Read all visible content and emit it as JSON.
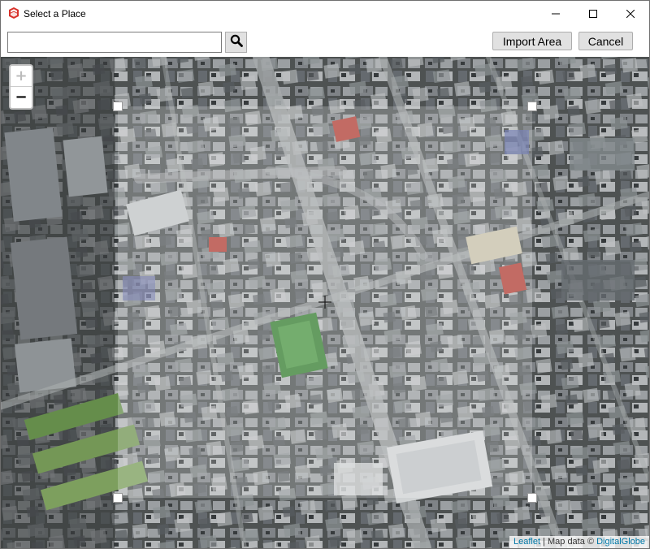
{
  "window": {
    "title": "Select a Place",
    "app_icon": "sketchup-logo-icon",
    "controls": [
      "minimize-icon",
      "maximize-icon",
      "close-icon"
    ]
  },
  "toolbar": {
    "search_value": "",
    "search_placeholder": "",
    "search_button_icon": "search-icon",
    "import_label": "Import Area",
    "cancel_label": "Cancel"
  },
  "map": {
    "zoom_in_label": "+",
    "zoom_out_label": "−",
    "selection_center_icon": "crosshair-icon",
    "attribution": {
      "provider_link": "Leaflet",
      "separator": " | Map data © ",
      "imagery_link": "DigitalGlobe"
    }
  },
  "colors": {
    "accent_link": "#0078a8",
    "app_icon_red": "#d8322a",
    "selection_overlay": "#ffffff"
  }
}
